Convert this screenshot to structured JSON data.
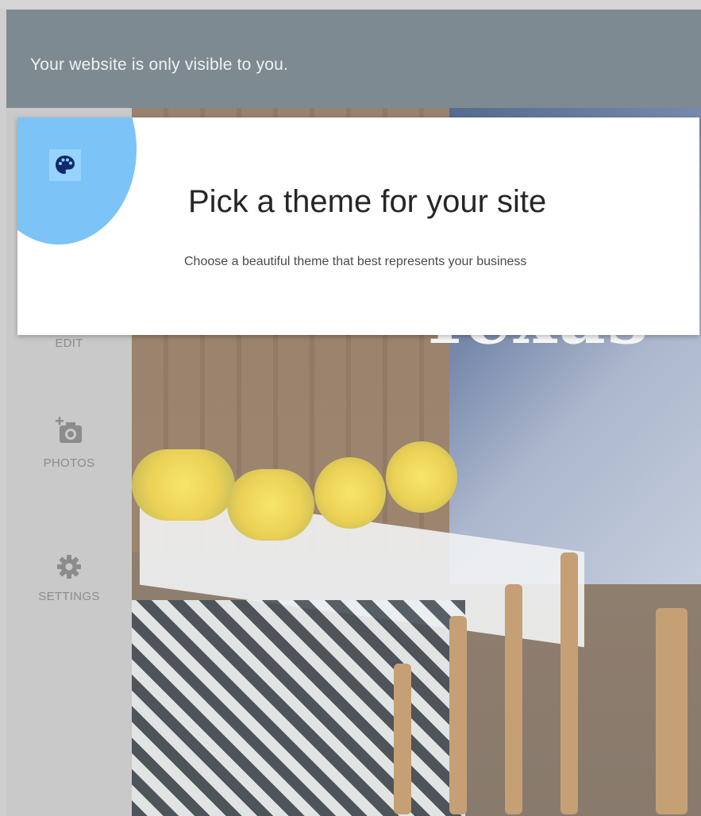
{
  "banner": {
    "text": "Your website is only visible to you."
  },
  "sidebar": {
    "items": [
      {
        "label": "EDIT",
        "icon": "edit-icon"
      },
      {
        "label": "PHOTOS",
        "icon": "add-photo-icon"
      },
      {
        "label": "SETTINGS",
        "icon": "gear-icon"
      }
    ]
  },
  "hero": {
    "text": "Texas"
  },
  "tip_card": {
    "icon": "palette-icon",
    "title": "Pick a theme for your site",
    "subtitle": "Choose a beautiful theme that best represents your business",
    "accent_color": "#7cc4f7"
  }
}
